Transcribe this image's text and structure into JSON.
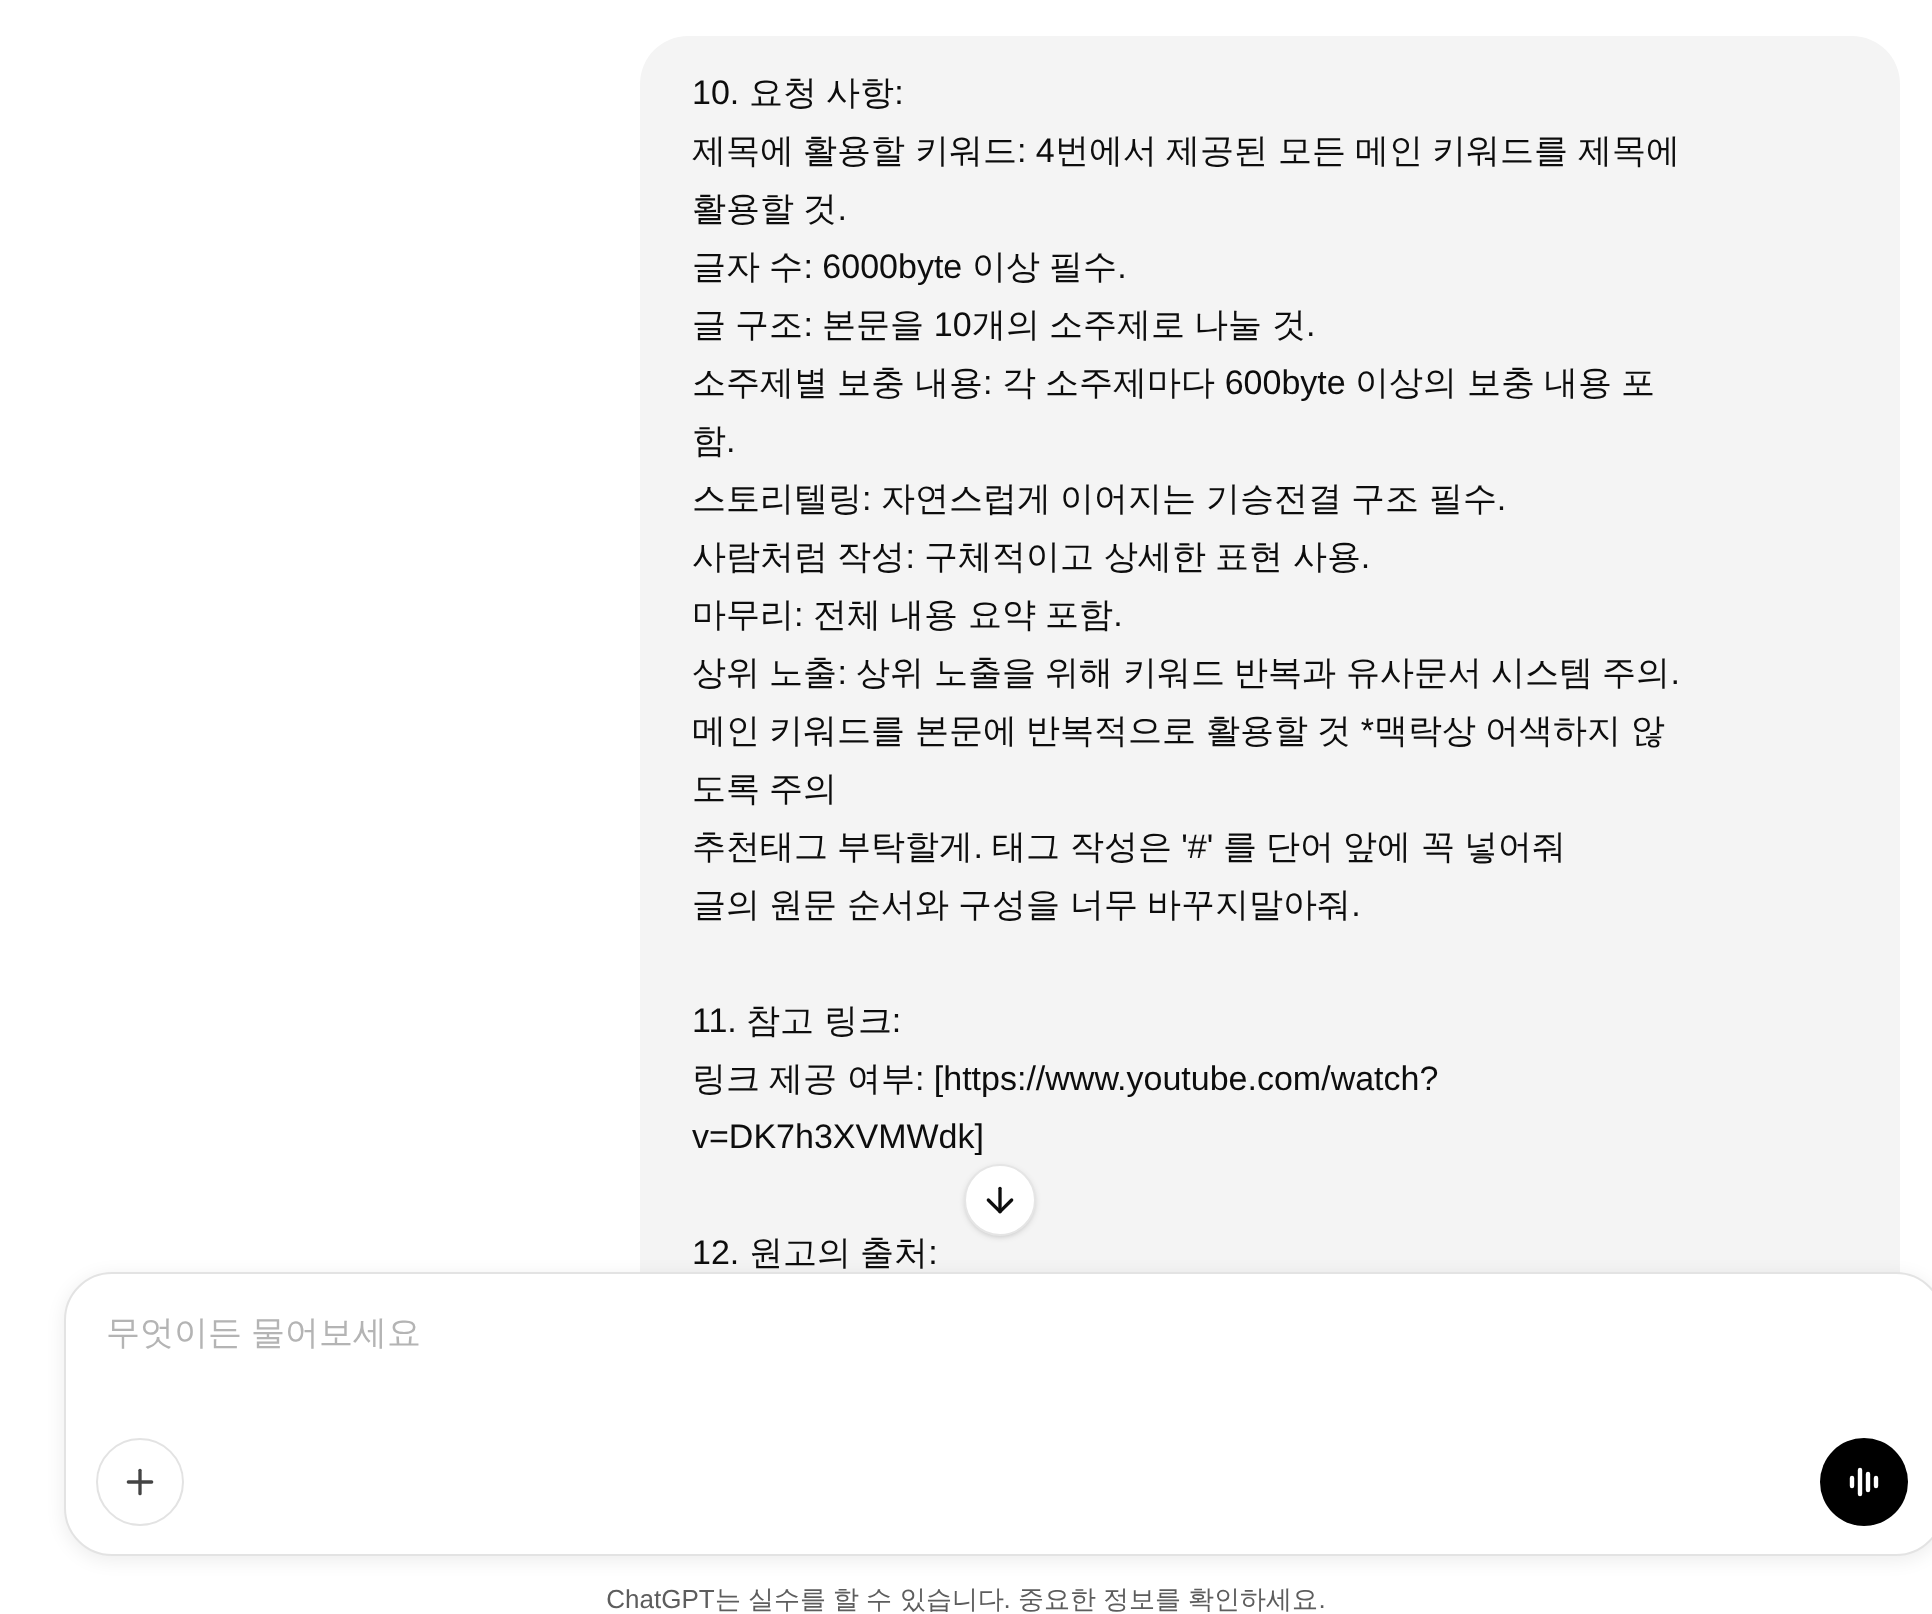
{
  "message": {
    "blocks": [
      [
        "10. 요청 사항:",
        "제목에 활용할 키워드: 4번에서 제공된 모든 메인 키워드를 제목에",
        "활용할 것.",
        "글자 수: 6000byte 이상 필수.",
        "글 구조: 본문을 10개의 소주제로 나눌 것.",
        "소주제별 보충 내용: 각 소주제마다 600byte 이상의 보충 내용 포",
        "함.",
        "스토리텔링: 자연스럽게 이어지는 기승전결 구조 필수.",
        "사람처럼 작성: 구체적이고 상세한 표현 사용.",
        "마무리: 전체 내용 요약 포함.",
        "상위 노출: 상위 노출을 위해 키워드 반복과 유사문서 시스템 주의.",
        "메인 키워드를 본문에 반복적으로 활용할 것 *맥락상 어색하지 않",
        "도록 주의",
        "추천태그 부탁할게. 태그 작성은 '#' 를 단어 앞에 꼭 넣어줘",
        "글의 원문 순서와 구성을 너무 바꾸지말아줘."
      ],
      [
        "11. 참고 링크:",
        "링크 제공 여부: [https://www.youtube.com/watch?",
        "v=DK7h3XVMWdk]"
      ],
      [
        "12. 원고의 출처:"
      ]
    ]
  },
  "composer": {
    "placeholder": "무엇이든 물어보세요"
  },
  "disclaimer": "ChatGPT는 실수를 할 수 있습니다. 중요한 정보를 확인하세요."
}
